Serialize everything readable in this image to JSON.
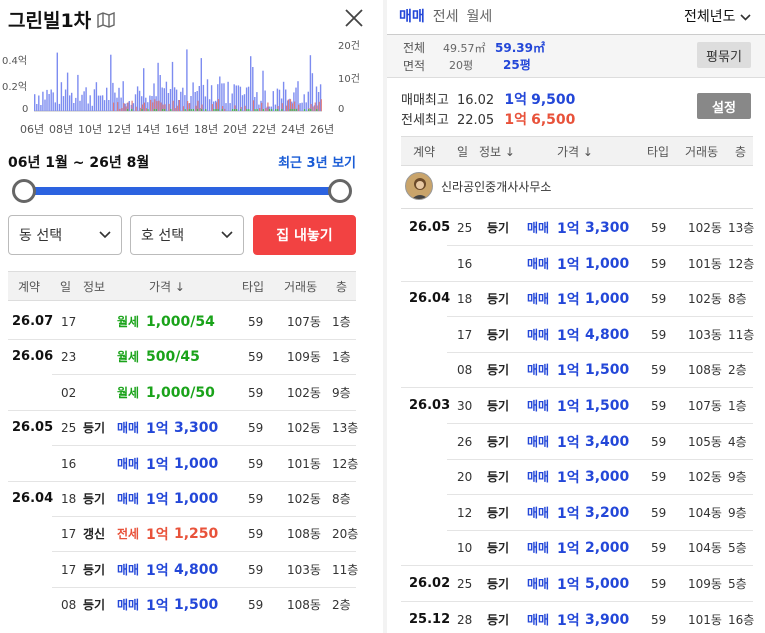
{
  "left": {
    "title": "그린빌1차",
    "chart": {
      "left_ticks": [
        "0.4억",
        "0.2억",
        "0"
      ],
      "right_ticks": [
        "20건",
        "10건",
        "0"
      ],
      "x_ticks": [
        "06년",
        "08년",
        "10년",
        "12년",
        "14년",
        "16년",
        "18년",
        "20년",
        "22년",
        "24년",
        "26년"
      ]
    },
    "range_label": "06년 1월 ~ 26년 8월",
    "recent_label": "최근 3년 보기",
    "dong_select": "동 선택",
    "ho_select": "호 선택",
    "sell_button": "집 내놓기",
    "headers": {
      "contract": "계약",
      "day": "일",
      "info": "정보",
      "price": "가격 ↓",
      "type": "타입",
      "dong": "거래동",
      "floor": "층"
    },
    "rows": [
      {
        "date": "26.07",
        "day": "17",
        "info": "",
        "kind": "월세",
        "price": "1,000/54",
        "type": "59",
        "dong": "107동",
        "floor": "1층",
        "color": "green"
      },
      {
        "date": "26.06",
        "day": "23",
        "info": "",
        "kind": "월세",
        "price": "500/45",
        "type": "59",
        "dong": "109동",
        "floor": "1층",
        "color": "green"
      },
      {
        "date": "",
        "day": "02",
        "info": "",
        "kind": "월세",
        "price": "1,000/50",
        "type": "59",
        "dong": "102동",
        "floor": "9층",
        "color": "green"
      },
      {
        "date": "26.05",
        "day": "25",
        "info": "등기",
        "kind": "매매",
        "price_big": "1억",
        "price": "3,300",
        "type": "59",
        "dong": "102동",
        "floor": "13층",
        "color": "blue"
      },
      {
        "date": "",
        "day": "16",
        "info": "",
        "kind": "매매",
        "price_big": "1억",
        "price": "1,000",
        "type": "59",
        "dong": "101동",
        "floor": "12층",
        "color": "blue"
      },
      {
        "date": "26.04",
        "day": "18",
        "info": "등기",
        "kind": "매매",
        "price_big": "1억",
        "price": "1,000",
        "type": "59",
        "dong": "102동",
        "floor": "8층",
        "color": "blue"
      },
      {
        "date": "",
        "day": "17",
        "info": "갱신",
        "kind": "전세",
        "price_big": "1억",
        "price": "1,250",
        "type": "59",
        "dong": "108동",
        "floor": "20층",
        "color": "red"
      },
      {
        "date": "",
        "day": "17",
        "info": "등기",
        "kind": "매매",
        "price_big": "1억",
        "price": "4,800",
        "type": "59",
        "dong": "103동",
        "floor": "11층",
        "color": "blue"
      },
      {
        "date": "",
        "day": "08",
        "info": "등기",
        "kind": "매매",
        "price_big": "1억",
        "price": "1,500",
        "type": "59",
        "dong": "108동",
        "floor": "2층",
        "color": "blue"
      }
    ]
  },
  "right": {
    "tabs": [
      "매매",
      "전세",
      "월세"
    ],
    "year_select": "전체년도",
    "area_labels": {
      "total": "전체",
      "exclusive": "면적"
    },
    "area_values": {
      "total_m2": "49.57㎡",
      "total_m2_bold": "59.39㎡",
      "pyeong": "20평",
      "pyeong_bold": "25평"
    },
    "pyeong_button": "평묶기",
    "max_sale": {
      "label": "매매최고",
      "date": "16.02",
      "big": "1억",
      "amount": "9,500"
    },
    "max_jeonse": {
      "label": "전세최고",
      "date": "22.05",
      "big": "1억",
      "amount": "6,500"
    },
    "settings_button": "설정",
    "headers": {
      "contract": "계약",
      "day": "일",
      "info": "정보 ↓",
      "price": "가격 ↓",
      "type": "타입",
      "dong": "거래동",
      "floor": "층"
    },
    "agent": "신라공인중개사사무소",
    "rows": [
      {
        "date": "26.05",
        "day": "25",
        "info": "등기",
        "kind": "매매",
        "price_big": "1억",
        "price": "3,300",
        "type": "59",
        "dong": "102동",
        "floor": "13층"
      },
      {
        "date": "",
        "day": "16",
        "info": "",
        "kind": "매매",
        "price_big": "1억",
        "price": "1,000",
        "type": "59",
        "dong": "101동",
        "floor": "12층"
      },
      {
        "date": "26.04",
        "day": "18",
        "info": "등기",
        "kind": "매매",
        "price_big": "1억",
        "price": "1,000",
        "type": "59",
        "dong": "102동",
        "floor": "8층"
      },
      {
        "date": "",
        "day": "17",
        "info": "등기",
        "kind": "매매",
        "price_big": "1억",
        "price": "4,800",
        "type": "59",
        "dong": "103동",
        "floor": "11층"
      },
      {
        "date": "",
        "day": "08",
        "info": "등기",
        "kind": "매매",
        "price_big": "1억",
        "price": "1,500",
        "type": "59",
        "dong": "108동",
        "floor": "2층"
      },
      {
        "date": "26.03",
        "day": "30",
        "info": "등기",
        "kind": "매매",
        "price_big": "1억",
        "price": "1,500",
        "type": "59",
        "dong": "107동",
        "floor": "1층"
      },
      {
        "date": "",
        "day": "26",
        "info": "등기",
        "kind": "매매",
        "price_big": "1억",
        "price": "3,400",
        "type": "59",
        "dong": "105동",
        "floor": "4층"
      },
      {
        "date": "",
        "day": "20",
        "info": "등기",
        "kind": "매매",
        "price_big": "1억",
        "price": "3,000",
        "type": "59",
        "dong": "102동",
        "floor": "9층"
      },
      {
        "date": "",
        "day": "12",
        "info": "등기",
        "kind": "매매",
        "price_big": "1억",
        "price": "3,200",
        "type": "59",
        "dong": "104동",
        "floor": "9층"
      },
      {
        "date": "",
        "day": "10",
        "info": "등기",
        "kind": "매매",
        "price_big": "1억",
        "price": "2,000",
        "type": "59",
        "dong": "104동",
        "floor": "5층"
      },
      {
        "date": "26.02",
        "day": "25",
        "info": "등기",
        "kind": "매매",
        "price_big": "1억",
        "price": "5,000",
        "type": "59",
        "dong": "109동",
        "floor": "5층"
      },
      {
        "date": "25.12",
        "day": "28",
        "info": "등기",
        "kind": "매매",
        "price_big": "1억",
        "price": "3,900",
        "type": "59",
        "dong": "101동",
        "floor": "16층"
      }
    ]
  },
  "colors": {
    "blue": "#2347d8",
    "green": "#1aa31a",
    "red": "#e8523a",
    "sell": "#f24242",
    "slider": "#2c63e0"
  }
}
